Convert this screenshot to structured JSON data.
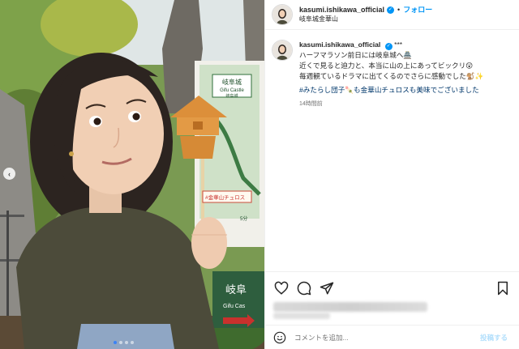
{
  "post": {
    "username": "kasumi.ishikawa_official",
    "verified": true,
    "separator": "•",
    "follow_label": "フォロー",
    "location": "岐阜城金華山"
  },
  "caption": {
    "username": "kasumi.ishikawa_official",
    "extra": "***",
    "lines": [
      "ハーフマラソン前日には岐阜城へ🏯",
      "近くで見ると迫力と、本当に山の上にあってビックリ😲",
      "毎週観ているドラマに出てくるのでさらに感動でした🐒✨"
    ],
    "hashtags": "#みたらし団子🍡も金華山チュロスも美味でございました",
    "time": "14時間前"
  },
  "media": {
    "sign_title": "岐阜城",
    "sign_subtitle": "Gifu Castle",
    "sign_sub2": "岐阜城",
    "lower_sign": "岐阜",
    "lower_sign_en": "Gifu Cas",
    "churro_tag": "#金華山チュロス",
    "distance": "5分"
  },
  "carousel": {
    "dots": 4,
    "active_index": 0
  },
  "icons": {
    "like": "heart-icon",
    "comment": "comment-icon",
    "share": "share-icon",
    "save": "bookmark-icon",
    "emoji": "smiley-icon",
    "verified": "verified-badge-icon",
    "prev": "chevron-left-icon"
  },
  "comment": {
    "placeholder": "コメントを追加...",
    "post_label": "投稿する"
  },
  "colors": {
    "accent": "#0095f6",
    "link": "#00376b",
    "muted": "#737373"
  }
}
